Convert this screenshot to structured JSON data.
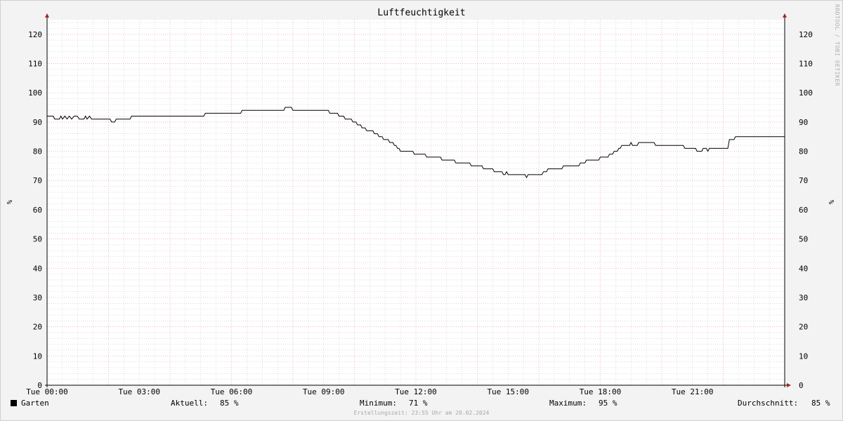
{
  "title": "Luftfeuchtigkeit",
  "vertical_label": "RRDTOOL / TOBI OETIKER",
  "footer": "Erstellungszeit: 23:55 Uhr am 20.02.2024",
  "legend": {
    "series_name": "Garten",
    "current_label": "Aktuell:",
    "current_value": "85 %",
    "min_label": "Minimum:",
    "min_value": "71 %",
    "max_label": "Maximum:",
    "max_value": "95 %",
    "avg_label": "Durchschnitt:",
    "avg_value": "85 %"
  },
  "chart_data": {
    "type": "line",
    "title": "Luftfeuchtigkeit",
    "ylabel": "%",
    "ylim": [
      0,
      125
    ],
    "xlim": [
      0,
      24
    ],
    "y_ticks": [
      0,
      10,
      20,
      30,
      40,
      50,
      60,
      70,
      80,
      90,
      100,
      110,
      120
    ],
    "x_ticks": [
      {
        "x": 0,
        "label": "Tue 00:00"
      },
      {
        "x": 3,
        "label": "Tue 03:00"
      },
      {
        "x": 6,
        "label": "Tue 06:00"
      },
      {
        "x": 9,
        "label": "Tue 09:00"
      },
      {
        "x": 12,
        "label": "Tue 12:00"
      },
      {
        "x": 15,
        "label": "Tue 15:00"
      },
      {
        "x": 18,
        "label": "Tue 18:00"
      },
      {
        "x": 21,
        "label": "Tue 21:00"
      }
    ],
    "grid": true,
    "legend_position": "bottom-left",
    "colors": {
      "line": "#000000",
      "major_grid": "#f0a0a0",
      "minor_grid": "#c8c8c8",
      "arrow": "#aa2222"
    },
    "series": [
      {
        "name": "Garten",
        "points": [
          [
            0.0,
            92
          ],
          [
            0.2,
            92
          ],
          [
            0.25,
            91
          ],
          [
            0.4,
            91
          ],
          [
            0.45,
            92
          ],
          [
            0.5,
            91
          ],
          [
            0.58,
            92
          ],
          [
            0.65,
            91
          ],
          [
            0.72,
            92
          ],
          [
            0.8,
            91
          ],
          [
            0.88,
            92
          ],
          [
            0.98,
            92
          ],
          [
            1.05,
            91
          ],
          [
            1.2,
            91
          ],
          [
            1.25,
            92
          ],
          [
            1.3,
            91
          ],
          [
            1.38,
            92
          ],
          [
            1.45,
            91
          ],
          [
            1.5,
            91
          ],
          [
            2.05,
            91
          ],
          [
            2.1,
            90
          ],
          [
            2.2,
            90
          ],
          [
            2.25,
            91
          ],
          [
            2.7,
            91
          ],
          [
            2.75,
            92
          ],
          [
            5.1,
            92
          ],
          [
            5.15,
            93
          ],
          [
            6.3,
            93
          ],
          [
            6.35,
            94
          ],
          [
            7.7,
            94
          ],
          [
            7.75,
            95
          ],
          [
            7.95,
            95
          ],
          [
            8.0,
            94
          ],
          [
            9.15,
            94
          ],
          [
            9.2,
            93
          ],
          [
            9.45,
            93
          ],
          [
            9.5,
            92
          ],
          [
            9.65,
            92
          ],
          [
            9.7,
            91
          ],
          [
            9.9,
            91
          ],
          [
            9.95,
            90
          ],
          [
            10.05,
            90
          ],
          [
            10.1,
            89
          ],
          [
            10.2,
            89
          ],
          [
            10.25,
            88
          ],
          [
            10.35,
            88
          ],
          [
            10.4,
            87
          ],
          [
            10.6,
            87
          ],
          [
            10.65,
            86
          ],
          [
            10.75,
            86
          ],
          [
            10.8,
            85
          ],
          [
            10.9,
            85
          ],
          [
            10.95,
            84
          ],
          [
            11.1,
            84
          ],
          [
            11.15,
            83
          ],
          [
            11.25,
            83
          ],
          [
            11.3,
            82
          ],
          [
            11.35,
            82
          ],
          [
            11.4,
            81
          ],
          [
            11.45,
            81
          ],
          [
            11.5,
            80
          ],
          [
            11.9,
            80
          ],
          [
            11.95,
            79
          ],
          [
            12.3,
            79
          ],
          [
            12.35,
            78
          ],
          [
            12.8,
            78
          ],
          [
            12.85,
            77
          ],
          [
            13.25,
            77
          ],
          [
            13.3,
            76
          ],
          [
            13.75,
            76
          ],
          [
            13.8,
            75
          ],
          [
            14.15,
            75
          ],
          [
            14.2,
            74
          ],
          [
            14.5,
            74
          ],
          [
            14.55,
            73
          ],
          [
            14.8,
            73
          ],
          [
            14.85,
            72
          ],
          [
            14.9,
            72
          ],
          [
            14.95,
            73
          ],
          [
            15.0,
            72
          ],
          [
            15.55,
            72
          ],
          [
            15.6,
            71
          ],
          [
            15.65,
            72
          ],
          [
            16.1,
            72
          ],
          [
            16.15,
            73
          ],
          [
            16.25,
            73
          ],
          [
            16.3,
            74
          ],
          [
            16.75,
            74
          ],
          [
            16.8,
            75
          ],
          [
            17.3,
            75
          ],
          [
            17.35,
            76
          ],
          [
            17.5,
            76
          ],
          [
            17.55,
            77
          ],
          [
            17.95,
            77
          ],
          [
            18.0,
            78
          ],
          [
            18.25,
            78
          ],
          [
            18.3,
            79
          ],
          [
            18.4,
            79
          ],
          [
            18.45,
            80
          ],
          [
            18.55,
            80
          ],
          [
            18.6,
            81
          ],
          [
            18.65,
            81
          ],
          [
            18.7,
            82
          ],
          [
            18.95,
            82
          ],
          [
            19.0,
            83
          ],
          [
            19.05,
            82
          ],
          [
            19.2,
            82
          ],
          [
            19.25,
            83
          ],
          [
            19.75,
            83
          ],
          [
            19.8,
            82
          ],
          [
            20.7,
            82
          ],
          [
            20.75,
            81
          ],
          [
            21.1,
            81
          ],
          [
            21.15,
            80
          ],
          [
            21.3,
            80
          ],
          [
            21.35,
            81
          ],
          [
            21.45,
            81
          ],
          [
            21.5,
            80
          ],
          [
            21.55,
            81
          ],
          [
            22.15,
            81
          ],
          [
            22.2,
            84
          ],
          [
            22.35,
            84
          ],
          [
            22.4,
            85
          ],
          [
            24.0,
            85
          ]
        ]
      }
    ]
  }
}
